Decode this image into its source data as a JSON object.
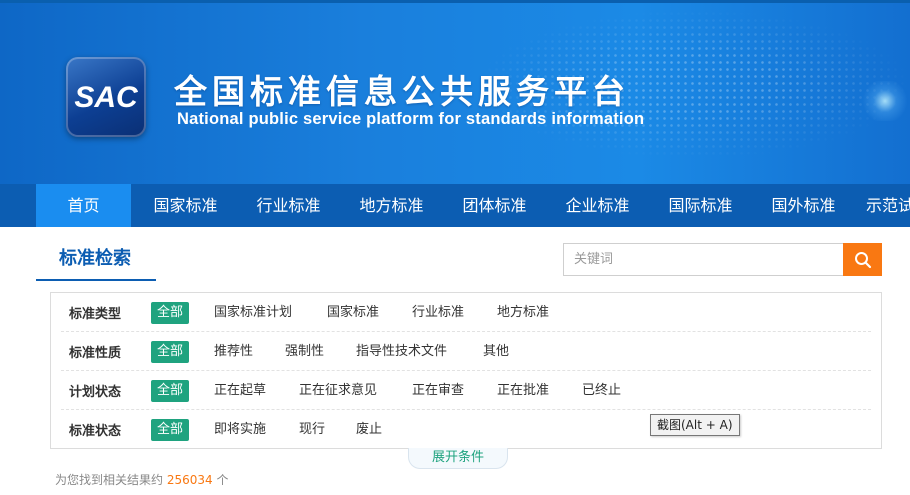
{
  "header": {
    "logo_text": "SAC",
    "title_cn": "全国标准信息公共服务平台",
    "title_en": "National public service platform  for standards information"
  },
  "nav": {
    "items": [
      {
        "label": "首页",
        "active": true
      },
      {
        "label": "国家标准"
      },
      {
        "label": "行业标准"
      },
      {
        "label": "地方标准"
      },
      {
        "label": "团体标准"
      },
      {
        "label": "企业标准"
      },
      {
        "label": "国际标准"
      },
      {
        "label": "国外标准"
      },
      {
        "label": "示范试"
      }
    ]
  },
  "search": {
    "title": "标准检索",
    "placeholder": "关键词",
    "value": "",
    "button_icon": "search-icon"
  },
  "filters": [
    {
      "label": "标准类型",
      "options": [
        "全部",
        "国家标准计划",
        "国家标准",
        "行业标准",
        "地方标准"
      ],
      "selected": "全部"
    },
    {
      "label": "标准性质",
      "options": [
        "全部",
        "推荐性",
        "强制性",
        "指导性技术文件",
        "其他"
      ],
      "selected": "全部"
    },
    {
      "label": "计划状态",
      "options": [
        "全部",
        "正在起草",
        "正在征求意见",
        "正在审查",
        "正在批准",
        "已终止"
      ],
      "selected": "全部"
    },
    {
      "label": "标准状态",
      "options": [
        "全部",
        "即将实施",
        "现行",
        "废止"
      ],
      "selected": "全部"
    }
  ],
  "tooltip": "截图(Alt + A)",
  "expand_label": "展开条件",
  "result": {
    "prefix": "为您找到相关结果约",
    "count": "256034",
    "suffix": "个"
  },
  "colors": {
    "brand_blue": "#0c5db2",
    "nav_active": "#1a8df0",
    "accent_orange": "#f97812",
    "selected_green": "#1fa37f"
  }
}
